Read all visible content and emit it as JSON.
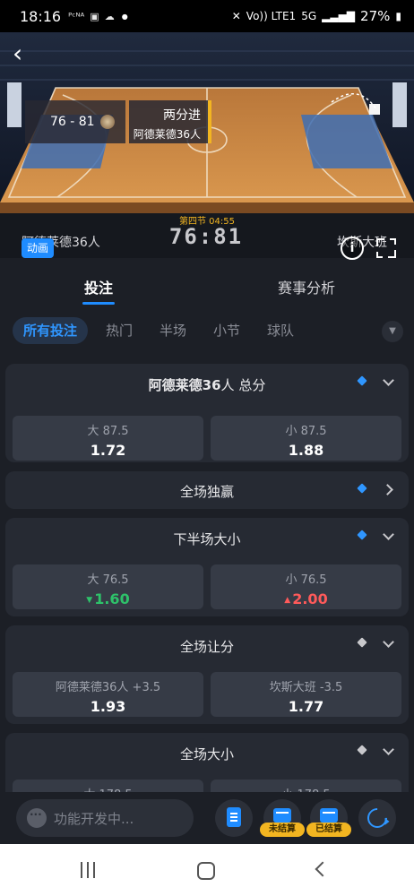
{
  "status_bar": {
    "time": "18:16",
    "notification_icons": [
      "pcna-icon",
      "image-icon",
      "cloud-icon"
    ],
    "network_label": "Vo)) LTE1",
    "signal_label": "5G",
    "battery": "27%"
  },
  "match": {
    "home_score": "76",
    "away_score": "81",
    "score_compact": "76 - 81",
    "event_title": "两分进",
    "event_team": "阿德莱德36人",
    "period": "第四节 04:55",
    "score_big": "76:81",
    "home_team": "阿德莱德36人",
    "away_team": "坎斯大班",
    "live_label": "动画",
    "info_label": "i"
  },
  "tabs": {
    "main": [
      "投注",
      "赛事分析"
    ],
    "active_main": 0,
    "sub": [
      "所有投注",
      "热门",
      "半场",
      "小节",
      "球队"
    ],
    "active_sub": 0
  },
  "markets": [
    {
      "title_team": "阿德莱德36",
      "title_rest": "人 总分",
      "pinned": true,
      "expanded": true,
      "options": [
        {
          "label": "大 87.5",
          "odds": "1.72",
          "trend": ""
        },
        {
          "label": "小 87.5",
          "odds": "1.88",
          "trend": ""
        }
      ]
    },
    {
      "title": "全场独赢",
      "pinned": true,
      "expanded": false
    },
    {
      "title": "下半场大小",
      "pinned": true,
      "expanded": true,
      "options": [
        {
          "label": "大 76.5",
          "odds": "1.60",
          "trend": "up"
        },
        {
          "label": "小 76.5",
          "odds": "2.00",
          "trend": "down"
        }
      ]
    },
    {
      "title": "全场让分",
      "pinned": false,
      "expanded": true,
      "options": [
        {
          "label": "阿德莱德36人 +3.5",
          "odds": "1.93",
          "trend": ""
        },
        {
          "label": "坎斯大班 -3.5",
          "odds": "1.77",
          "trend": ""
        }
      ]
    },
    {
      "title": "全场大小",
      "pinned": false,
      "expanded": true,
      "options": [
        {
          "label": "大 178.5",
          "odds": "",
          "trend": ""
        },
        {
          "label": "小 178.5",
          "odds": "",
          "trend": ""
        }
      ]
    }
  ],
  "bottom_bar": {
    "input_placeholder": "功能开发中...",
    "unsettled_label": "未结算",
    "settled_label": "已结算"
  },
  "colors": {
    "accent": "#1f8cff",
    "gold": "#f2b521",
    "odds_up": "#2ec26a",
    "odds_down": "#ff5a5a",
    "background": "#1c1f26",
    "card": "#262a33"
  }
}
